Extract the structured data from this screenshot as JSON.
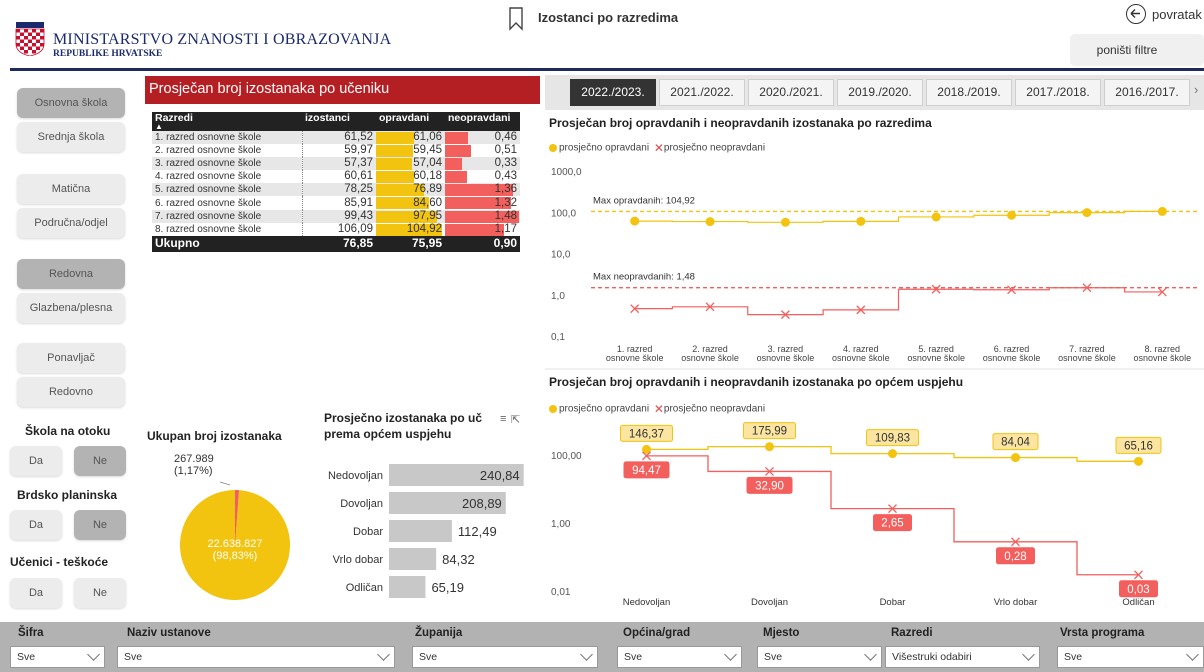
{
  "header": {
    "ministry_name": "MINISTARSTVO ZNANOSTI I OBRAZOVANJA",
    "ministry_sub": "REPUBLIKE HRVATSKE",
    "page_title": "Izostanci po razredima",
    "back_label": "povratak",
    "reset_label": "poništi filtre"
  },
  "slicers": {
    "school_type": [
      "Osnovna škola",
      "Srednja škola"
    ],
    "school_kind": [
      "Matična",
      "Područna/odjel"
    ],
    "program": [
      "Redovna",
      "Glazbena/plesna"
    ],
    "repeat": [
      "Ponavljač",
      "Redovno"
    ],
    "island_title": "Škola na otoku",
    "mountain_title": "Brdsko planinska",
    "difficulty_title": "Učenici - teškoće",
    "yes": "Da",
    "no": "Ne"
  },
  "table": {
    "title": "Prosječan broj izostanaka po učeniku",
    "headers": [
      "Razredi",
      "izostanci",
      "opravdani",
      "neopravdani"
    ],
    "rows": [
      {
        "name": "1. razred osnovne škole",
        "izostanci": "61,52",
        "opravdani": "61,06",
        "neopravdani": "0,46"
      },
      {
        "name": "2. razred osnovne škole",
        "izostanci": "59,97",
        "opravdani": "59,45",
        "neopravdani": "0,51"
      },
      {
        "name": "3. razred osnovne škole",
        "izostanci": "57,37",
        "opravdani": "57,04",
        "neopravdani": "0,33"
      },
      {
        "name": "4. razred osnovne škole",
        "izostanci": "60,61",
        "opravdani": "60,18",
        "neopravdani": "0,43"
      },
      {
        "name": "5. razred osnovne škole",
        "izostanci": "78,25",
        "opravdani": "76,89",
        "neopravdani": "1,36"
      },
      {
        "name": "6. razred osnovne škole",
        "izostanci": "85,91",
        "opravdani": "84,60",
        "neopravdani": "1,32"
      },
      {
        "name": "7. razred osnovne škole",
        "izostanci": "99,43",
        "opravdani": "97,95",
        "neopravdani": "1,48"
      },
      {
        "name": "8. razred osnovne škole",
        "izostanci": "106,09",
        "opravdani": "104,92",
        "neopravdani": "1,17"
      }
    ],
    "total": {
      "name": "Ukupno",
      "izostanci": "76,85",
      "opravdani": "75,95",
      "neopravdani": "0,90"
    }
  },
  "year_tabs": [
    "2022./2023.",
    "2021./2022.",
    "2020./2021.",
    "2019./2020.",
    "2018./2019.",
    "2017./2018.",
    "2016./2017."
  ],
  "colors": {
    "opravdani": "#f2c30f",
    "neopravdani": "#f25f5c",
    "header_red": "#b41f24",
    "dark": "#222222"
  },
  "legend": {
    "justified": "prosječno opravdani",
    "unjustified": "prosječno neopravdani"
  },
  "line_chart_grades": {
    "title": "Prosječan broj opravdanih i neopravdanih izostanaka po razredima",
    "max_justified_label": "Max opravdanih: 104,92",
    "max_unjustified_label": "Max neopravdanih: 1,48",
    "y_ticks": [
      "1000,0",
      "100,0",
      "10,0",
      "1,0",
      "0,1"
    ]
  },
  "line_chart_success": {
    "title": "Prosječan broj opravdanih i neopravdanih izostanaka po općem uspjehu",
    "y_ticks": [
      "100,00",
      "1,00",
      "0,01"
    ]
  },
  "pie": {
    "title": "Ukupan broj izostanaka",
    "unjustified_value": "267.989",
    "unjustified_pct": "(1,17%)",
    "justified_value": "22.638.827",
    "justified_pct": "(98,83%)"
  },
  "bars": {
    "title_line1": "Prosječno izostanaka po uč",
    "title_line2": "prema općem uspjehu"
  },
  "chart_data": [
    {
      "type": "line",
      "title": "Prosječan broj opravdanih i neopravdanih izostanaka po razredima",
      "categories": [
        "1. razred osnovne škole",
        "2. razred osnovne škole",
        "3. razred osnovne škole",
        "4. razred osnovne škole",
        "5. razred osnovne škole",
        "6. razred osnovne škole",
        "7. razred osnovne škole",
        "8. razred osnovne škole"
      ],
      "series": [
        {
          "name": "prosječno opravdani",
          "values": [
            61.06,
            59.45,
            57.04,
            60.18,
            76.89,
            84.6,
            97.95,
            104.92
          ]
        },
        {
          "name": "prosječno neopravdani",
          "values": [
            0.46,
            0.51,
            0.33,
            0.43,
            1.36,
            1.32,
            1.48,
            1.17
          ]
        }
      ],
      "y_scale": "log",
      "ylim": [
        0.1,
        1000
      ],
      "reference_lines": [
        104.92,
        1.48
      ],
      "legend_position": "top-left"
    },
    {
      "type": "line",
      "title": "Prosječan broj opravdanih i neopravdanih izostanaka po općem uspjehu",
      "categories": [
        "Nedovoljan",
        "Dovoljan",
        "Dobar",
        "Vrlo dobar",
        "Odličan"
      ],
      "series": [
        {
          "name": "prosječno opravdani",
          "values": [
            146.37,
            175.99,
            109.83,
            84.04,
            65.16
          ],
          "labels": [
            "146,37",
            "175,99",
            "109,83",
            "84,04",
            "65,16"
          ]
        },
        {
          "name": "prosječno neopravdani",
          "values": [
            94.47,
            32.9,
            2.65,
            0.28,
            0.03
          ],
          "labels": [
            "94,47",
            "32,90",
            "2,65",
            "0,28",
            "0,03"
          ]
        }
      ],
      "y_scale": "log",
      "ylim": [
        0.01,
        1000
      ],
      "legend_position": "top-left"
    },
    {
      "type": "pie",
      "title": "Ukupan broj izostanaka",
      "categories": [
        "opravdani",
        "neopravdani"
      ],
      "values": [
        22638827,
        267989
      ],
      "percent": [
        98.83,
        1.17
      ]
    },
    {
      "type": "bar",
      "orientation": "horizontal",
      "title": "Prosječno izostanaka po učeniku prema općem uspjehu",
      "categories": [
        "Nedovoljan",
        "Dovoljan",
        "Dobar",
        "Vrlo dobar",
        "Odličan"
      ],
      "values": [
        240.84,
        208.89,
        112.49,
        84.32,
        65.19
      ],
      "labels": [
        "240,84",
        "208,89",
        "112,49",
        "84,32",
        "65,19"
      ]
    }
  ],
  "filters": [
    {
      "label": "Šifra",
      "value": "Sve"
    },
    {
      "label": "Naziv ustanove",
      "value": "Sve"
    },
    {
      "label": "Županija",
      "value": "Sve"
    },
    {
      "label": "Općina/grad",
      "value": "Sve"
    },
    {
      "label": "Mjesto",
      "value": "Sve"
    },
    {
      "label": "Razredi",
      "value": "Višestruki odabiri"
    },
    {
      "label": "Vrsta programa",
      "value": "Sve"
    }
  ]
}
